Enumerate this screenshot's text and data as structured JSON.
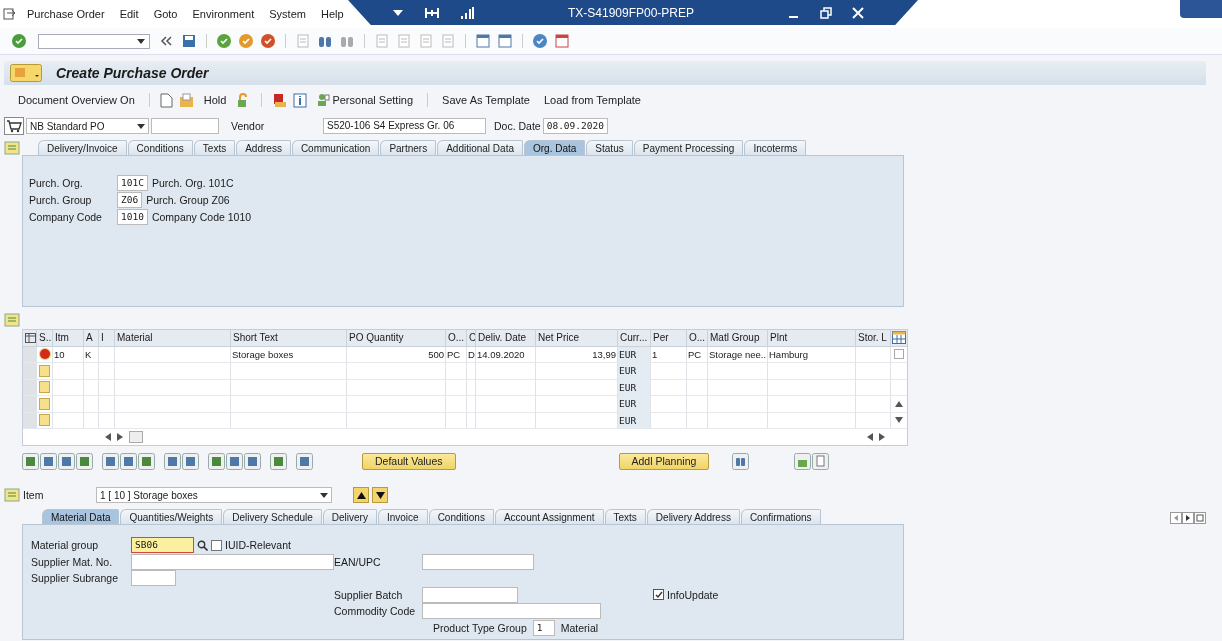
{
  "menu": [
    "Purchase Order",
    "Edit",
    "Goto",
    "Environment",
    "System",
    "Help"
  ],
  "window": {
    "title": "TX-S41909FP00-PREP"
  },
  "screen_title": "Create Purchase Order",
  "app_toolbar": [
    "Document Overview On",
    "Hold",
    "Personal Setting",
    "Save As Template",
    "Load from Template"
  ],
  "header": {
    "doc_type": "NB Standard PO",
    "vendor_label": "Vendor",
    "vendor": "S520-106 S4 Express Gr. 06",
    "date_label": "Doc. Date",
    "date": "08.09.2020"
  },
  "header_tabs": [
    {
      "label": "Delivery/Invoice",
      "selected": false
    },
    {
      "label": "Conditions",
      "selected": false
    },
    {
      "label": "Texts",
      "selected": false
    },
    {
      "label": "Address",
      "selected": false
    },
    {
      "label": "Communication",
      "selected": false
    },
    {
      "label": "Partners",
      "selected": false
    },
    {
      "label": "Additional Data",
      "selected": false
    },
    {
      "label": "Org. Data",
      "selected": true
    },
    {
      "label": "Status",
      "selected": false
    },
    {
      "label": "Payment Processing",
      "selected": false
    },
    {
      "label": "Incoterms",
      "selected": false
    }
  ],
  "org_fields": [
    {
      "label": "Purch. Org.",
      "value": "101C",
      "text": "Purch. Org. 101C"
    },
    {
      "label": "Purch. Group",
      "value": "Z06",
      "text": "Purch. Group Z06"
    },
    {
      "label": "Company Code",
      "value": "1010",
      "text": "Company Code 1010"
    }
  ],
  "items_table": {
    "columns": [
      "S..",
      "Itm",
      "A",
      "I",
      "Material",
      "Short Text",
      "PO Quantity",
      "O...",
      "C",
      "Deliv. Date",
      "Net Price",
      "Curr...",
      "Per",
      "O...",
      "Matl Group",
      "Plnt",
      "Stor. L"
    ],
    "rows": [
      {
        "kind": "item",
        "color": "#d42a1a",
        "cells": [
          "",
          "10",
          "K",
          "",
          "",
          "Storage boxes",
          "500",
          "PC",
          "D",
          "14.09.2020",
          "13,99",
          "EUR",
          "1",
          "PC",
          "Storage nee..",
          "Hamburg",
          ""
        ]
      },
      {
        "kind": "empty",
        "color": "#f7e08c",
        "cells": [
          "",
          "",
          "",
          "",
          "",
          "",
          "",
          "",
          "",
          "",
          "",
          "EUR",
          "",
          "",
          "",
          "",
          ""
        ]
      },
      {
        "kind": "empty",
        "color": "#f7e08c",
        "cells": [
          "",
          "",
          "",
          "",
          "",
          "",
          "",
          "",
          "",
          "",
          "",
          "EUR",
          "",
          "",
          "",
          "",
          ""
        ]
      },
      {
        "kind": "empty",
        "color": "#f7e08c",
        "cells": [
          "",
          "",
          "",
          "",
          "",
          "",
          "",
          "",
          "",
          "",
          "",
          "EUR",
          "",
          "",
          "",
          "",
          ""
        ]
      },
      {
        "kind": "empty",
        "color": "#f7e08c",
        "cells": [
          "",
          "",
          "",
          "",
          "",
          "",
          "",
          "",
          "",
          "",
          "",
          "EUR",
          "",
          "",
          "",
          "",
          ""
        ]
      }
    ]
  },
  "item_buttons": [
    "Default Values",
    "Addl Planning"
  ],
  "item_selector": {
    "label": "Item",
    "value": "1 [ 10 ] Storage boxes"
  },
  "item_tabs": [
    {
      "label": "Material Data",
      "selected": true
    },
    {
      "label": "Quantities/Weights",
      "selected": false
    },
    {
      "label": "Delivery Schedule",
      "selected": false
    },
    {
      "label": "Delivery",
      "selected": false
    },
    {
      "label": "Invoice",
      "selected": false
    },
    {
      "label": "Conditions",
      "selected": false
    },
    {
      "label": "Account Assignment",
      "selected": false
    },
    {
      "label": "Texts",
      "selected": false
    },
    {
      "label": "Delivery Address",
      "selected": false
    },
    {
      "label": "Confirmations",
      "selected": false
    }
  ],
  "material_data": {
    "material_group": {
      "label": "Material group",
      "value": "SB06",
      "highlighted": true
    },
    "iuid": {
      "label": "IUID-Relevant",
      "checked": false
    },
    "supplier_mat_no": {
      "label": "Supplier Mat. No."
    },
    "ean_upc": {
      "label": "EAN/UPC"
    },
    "supplier_subrange": {
      "label": "Supplier Subrange"
    },
    "supplier_batch": {
      "label": "Supplier Batch"
    },
    "info_update": {
      "label": "InfoUpdate",
      "checked": true
    },
    "commodity_code": {
      "label": "Commodity Code"
    },
    "product_type_group": {
      "label": "Product Type Group",
      "value": "1",
      "text": "Material"
    }
  }
}
